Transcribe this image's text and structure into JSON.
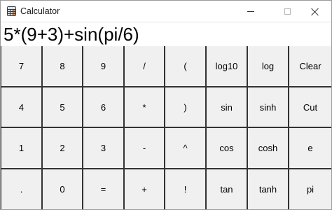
{
  "window": {
    "title": "Calculator",
    "icon": "calculator-icon",
    "controls": [
      "minimize-icon",
      "maximize-icon",
      "close-icon"
    ]
  },
  "display": {
    "expression": "5*(9+3)+sin(pi/6)"
  },
  "keypad": {
    "rows": [
      [
        "7",
        "8",
        "9",
        "/",
        "(",
        "log10",
        "log",
        "Clear"
      ],
      [
        "4",
        "5",
        "6",
        "*",
        ")",
        "sin",
        "sinh",
        "Cut"
      ],
      [
        "1",
        "2",
        "3",
        "-",
        "^",
        "cos",
        "cosh",
        "e"
      ],
      [
        ".",
        "0",
        "=",
        "+",
        "!",
        "tan",
        "tanh",
        "pi"
      ]
    ]
  },
  "colors": {
    "key_background": "#f0f0f0",
    "key_border": "#333333",
    "window_background": "#ffffff"
  }
}
